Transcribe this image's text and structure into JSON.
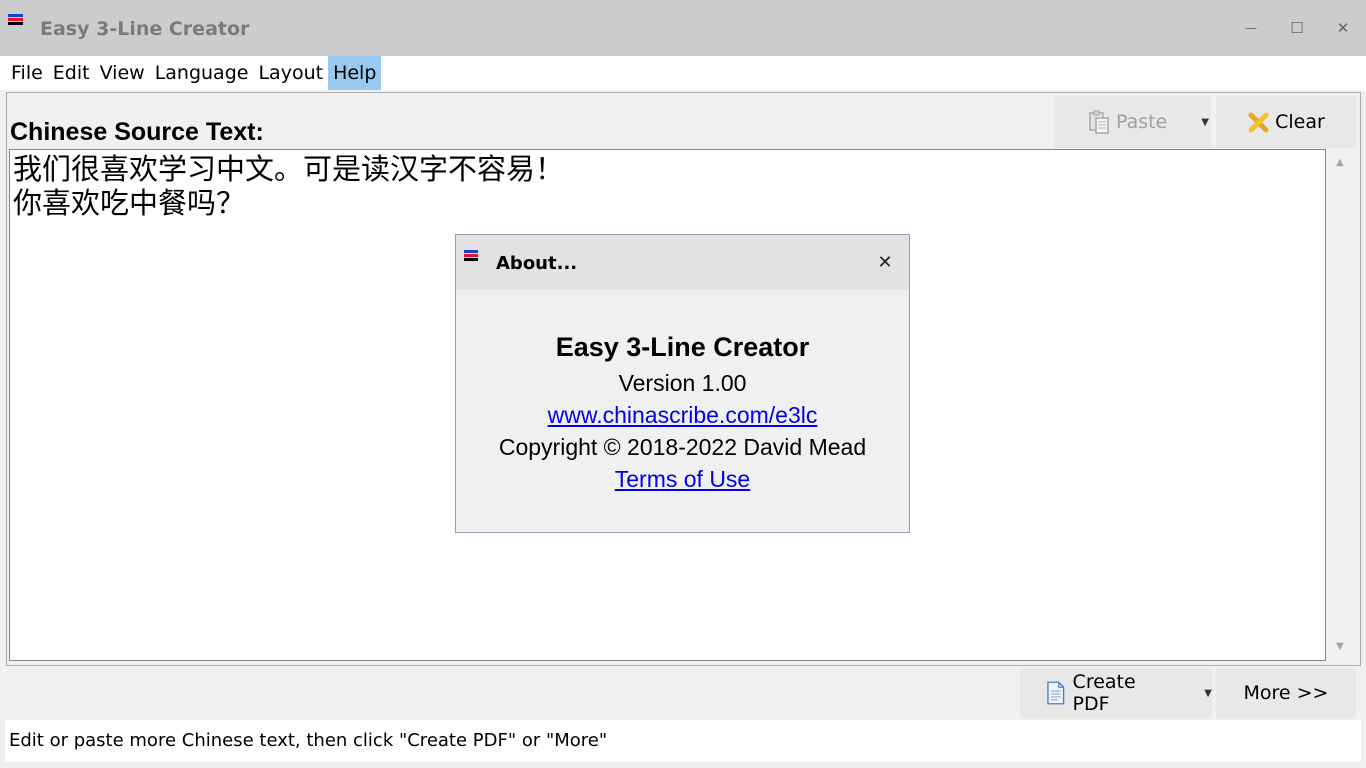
{
  "window": {
    "title": "Easy 3-Line Creator",
    "controls": {
      "minimize": "—",
      "maximize": "☐",
      "close": "✕"
    }
  },
  "menu": {
    "items": [
      {
        "label": "File"
      },
      {
        "label": "Edit"
      },
      {
        "label": "View"
      },
      {
        "label": "Language"
      },
      {
        "label": "Layout"
      },
      {
        "label": "Help",
        "active": true
      }
    ]
  },
  "source": {
    "heading": "Chinese Source Text:",
    "lines": [
      "我们很喜欢学习中文。可是读汉字不容易！",
      "你喜欢吃中餐吗？"
    ]
  },
  "toolbar": {
    "paste_label": "Paste",
    "clear_label": "Clear"
  },
  "actions": {
    "create_pdf_label": "Create PDF",
    "more_label": "More >>"
  },
  "status": {
    "text": "Edit or paste more Chinese text, then click \"Create PDF\" or \"More\""
  },
  "about_dialog": {
    "title": "About...",
    "app_name": "Easy 3-Line Creator",
    "version": "Version 1.00",
    "website": "www.chinascribe.com/e3lc",
    "copyright": "Copyright © 2018-2022 David Mead",
    "terms_link": "Terms of Use",
    "close_glyph": "✕"
  },
  "colors": {
    "title_bar": "#cccccc",
    "menu_active": "#99c9ef",
    "link": "#0000ee",
    "icon_red": "#e81123",
    "icon_blue": "#1a3fd6",
    "icon_black": "#000000"
  },
  "icons": [
    "app-flag-icon",
    "paste-icon",
    "clear-x-icon",
    "pdf-document-icon",
    "dropdown-arrow-icon",
    "close-icon"
  ]
}
